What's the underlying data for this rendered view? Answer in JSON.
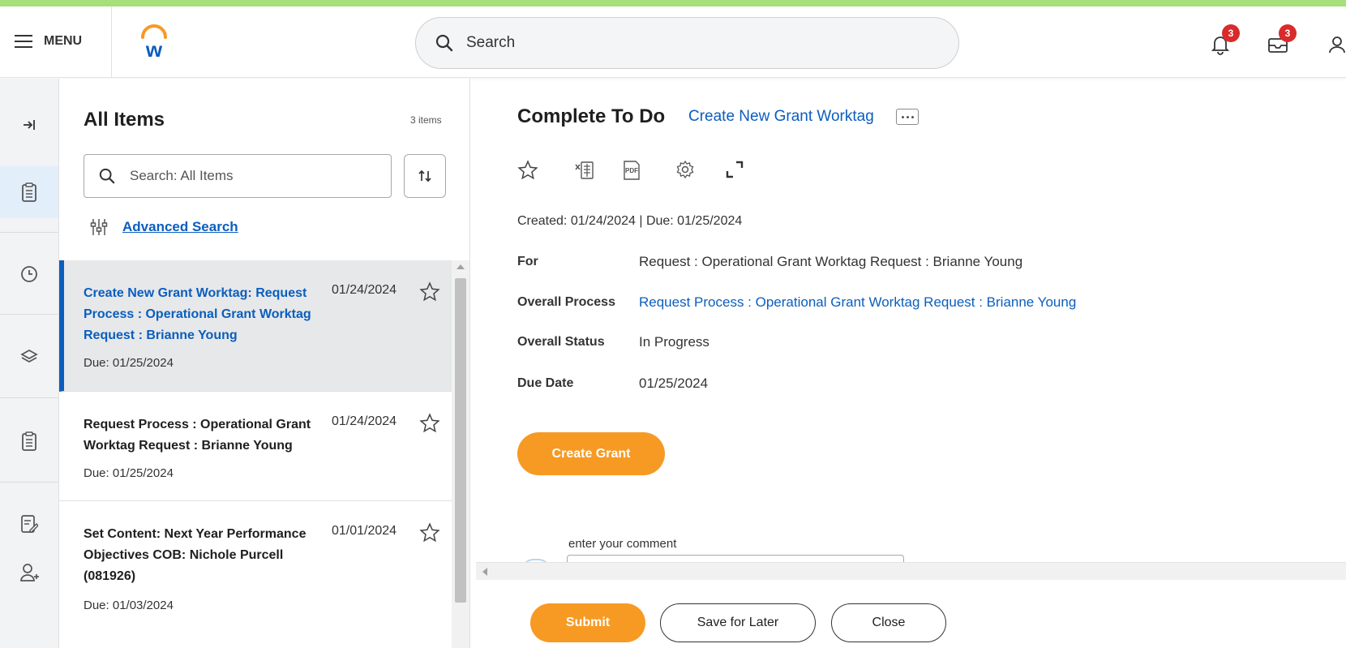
{
  "header": {
    "menu_label": "MENU",
    "search_placeholder": "Search",
    "notifications_count": "3",
    "inbox_count": "3"
  },
  "list": {
    "title": "All Items",
    "count": "3 items",
    "search_placeholder": "Search: All Items",
    "advanced_search": "Advanced Search",
    "items": [
      {
        "title": "Create New Grant Worktag: Request Process : Operational Grant Worktag Request : Brianne Young",
        "date": "01/24/2024",
        "due": "Due: 01/25/2024"
      },
      {
        "title": "Request Process : Operational Grant Worktag Request : Brianne Young",
        "date": "01/24/2024",
        "due": "Due: 01/25/2024"
      },
      {
        "title": "Set Content: Next Year Performance Objectives COB: Nichole Purcell (081926)",
        "date": "01/01/2024",
        "due": "Due: 01/03/2024"
      }
    ]
  },
  "detail": {
    "title": "Complete To Do",
    "task_link": "Create New Grant Worktag",
    "created": "Created: 01/24/2024 | Due: 01/25/2024",
    "fields": [
      {
        "label": "For",
        "value": "Request : Operational Grant Worktag Request : Brianne Young"
      },
      {
        "label": "Overall Process",
        "value": "Request Process : Operational Grant Worktag Request : Brianne Young"
      },
      {
        "label": "Overall Status",
        "value": "In Progress"
      },
      {
        "label": "Due Date",
        "value": "01/25/2024"
      }
    ],
    "create_grant_label": "Create Grant",
    "comment_label": "enter your comment"
  },
  "footer": {
    "submit": "Submit",
    "save_for_later": "Save for Later",
    "close": "Close"
  },
  "colors": {
    "accent_orange": "#f79a24",
    "link_blue": "#0b5ebd",
    "badge_red": "#d92b2b",
    "top_stripe": "#a6e07a"
  }
}
